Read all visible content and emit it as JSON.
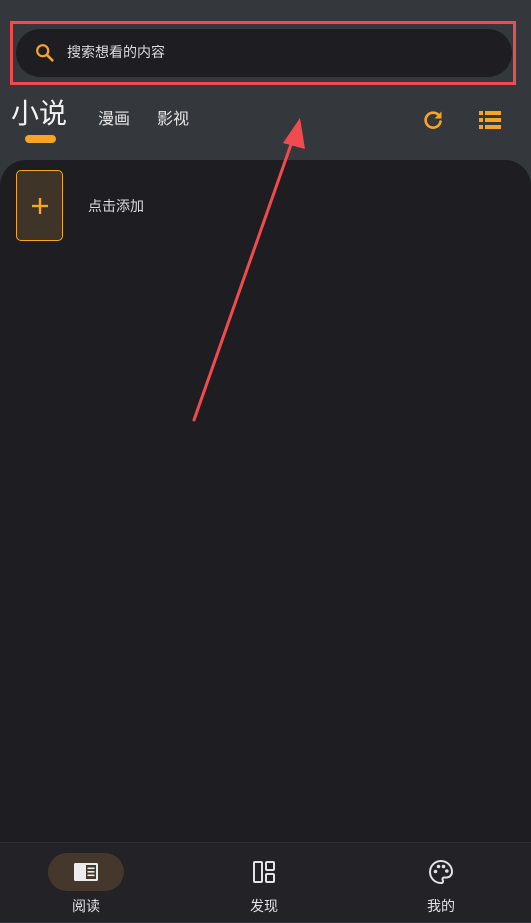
{
  "search": {
    "placeholder": "搜索想看的内容",
    "icon": "search-icon"
  },
  "tabs": [
    {
      "label": "小说",
      "active": true
    },
    {
      "label": "漫画",
      "active": false
    },
    {
      "label": "影视",
      "active": false
    }
  ],
  "toolbar": {
    "refresh_icon": "refresh-icon",
    "list_icon": "list-view-icon"
  },
  "bookshelf": {
    "add_label": "点击添加",
    "add_icon": "plus-icon"
  },
  "bottom_nav": [
    {
      "label": "阅读",
      "icon": "book-icon",
      "active": true
    },
    {
      "label": "发现",
      "icon": "dashboard-icon",
      "active": false
    },
    {
      "label": "我的",
      "icon": "palette-icon",
      "active": false
    }
  ],
  "colors": {
    "accent": "#f6a622",
    "annotation": "#f24b4f",
    "header_bg": "#34373b",
    "content_bg": "#1e1d21"
  }
}
